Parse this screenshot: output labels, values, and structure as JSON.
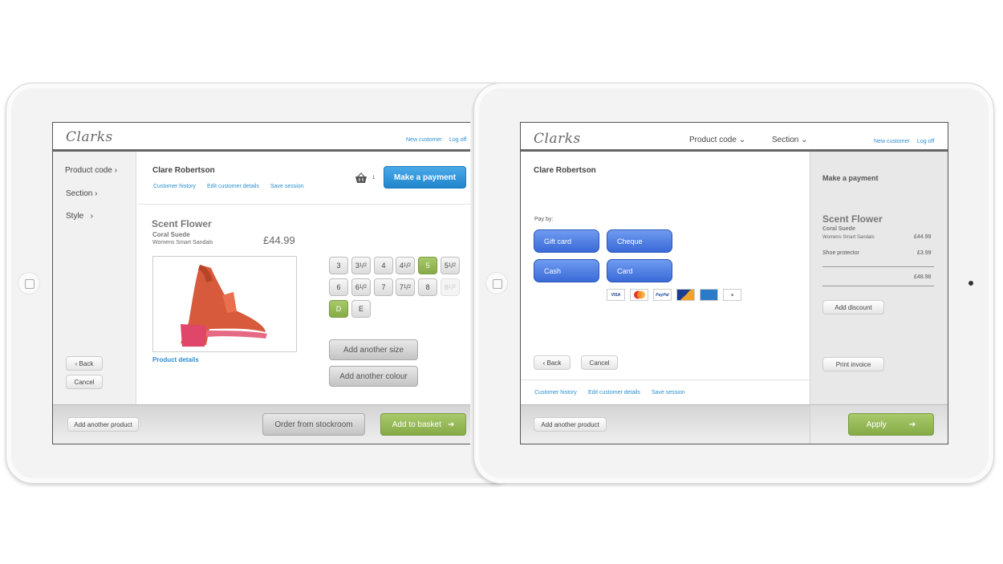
{
  "left": {
    "logo": "Clarks",
    "top_links": {
      "new_customer": "New customer",
      "log_off": "Log off"
    },
    "sidebar": {
      "items": [
        {
          "label": "Product code"
        },
        {
          "label": "Section"
        },
        {
          "label": "Style"
        }
      ],
      "back_label": "Back",
      "cancel_label": "Cancel"
    },
    "customer": {
      "name": "Clare Robertson",
      "links": {
        "history": "Customer history",
        "edit": "Edit customer details",
        "save": "Save session"
      }
    },
    "basket_count": "1",
    "make_payment_label": "Make a payment",
    "product": {
      "name": "Scent Flower",
      "material": "Coral Suede",
      "category": "Womens Smart Sandals",
      "price": "£44.99",
      "details_link": "Product details"
    },
    "sizes_row1": [
      {
        "whole": "3",
        "half": false
      },
      {
        "whole": "3",
        "half": true
      },
      {
        "whole": "4",
        "half": false
      },
      {
        "whole": "4",
        "half": true
      },
      {
        "whole": "5",
        "half": false,
        "selected": true
      },
      {
        "whole": "5",
        "half": true
      }
    ],
    "sizes_row2": [
      {
        "whole": "6",
        "half": false
      },
      {
        "whole": "6",
        "half": true
      },
      {
        "whole": "7",
        "half": false
      },
      {
        "whole": "7",
        "half": true
      },
      {
        "whole": "8",
        "half": false
      },
      {
        "whole": "8",
        "half": true,
        "disabled": true
      }
    ],
    "widths": [
      {
        "label": "D",
        "selected": true
      },
      {
        "label": "E",
        "selected": false
      }
    ],
    "add_size_label": "Add another size",
    "add_colour_label": "Add another colour",
    "footer": {
      "add_product_label": "Add another product",
      "stockroom_label": "Order from stockroom",
      "add_basket_label": "Add to basket"
    }
  },
  "right": {
    "logo": "Clarks",
    "top_nav": {
      "product_code": "Product code",
      "section": "Section"
    },
    "top_links": {
      "new_customer": "New customer",
      "log_off": "Log off"
    },
    "customer": {
      "name": "Clare Robertson",
      "links": {
        "history": "Customer history",
        "edit": "Edit customer details",
        "save": "Save session"
      }
    },
    "pay_by_label": "Pay by:",
    "pay_options": {
      "gift_card": "Gift card",
      "cheque": "Cheque",
      "cash": "Cash",
      "card": "Card"
    },
    "card_logos": [
      "VISA",
      "MasterCard",
      "PayPal",
      "DELTA",
      "AMEX",
      "Square"
    ],
    "back_label": "Back",
    "cancel_label": "Cancel",
    "summary": {
      "title": "Make a payment",
      "product_name": "Scent Flower",
      "material": "Coral Suede",
      "category": "Womens Smart Sandals",
      "price": "£44.99",
      "protector_label": "Shoe protector",
      "protector_price": "£3.99",
      "total": "£48.98",
      "add_discount_label": "Add discount",
      "print_invoice_label": "Print invoice"
    },
    "footer": {
      "add_product_label": "Add another product",
      "apply_label": "Apply"
    }
  },
  "colors": {
    "link": "#2a8fd0",
    "green": "#86ab47",
    "blue": "#2185cc",
    "pay_blue": "#3a6ad8"
  }
}
